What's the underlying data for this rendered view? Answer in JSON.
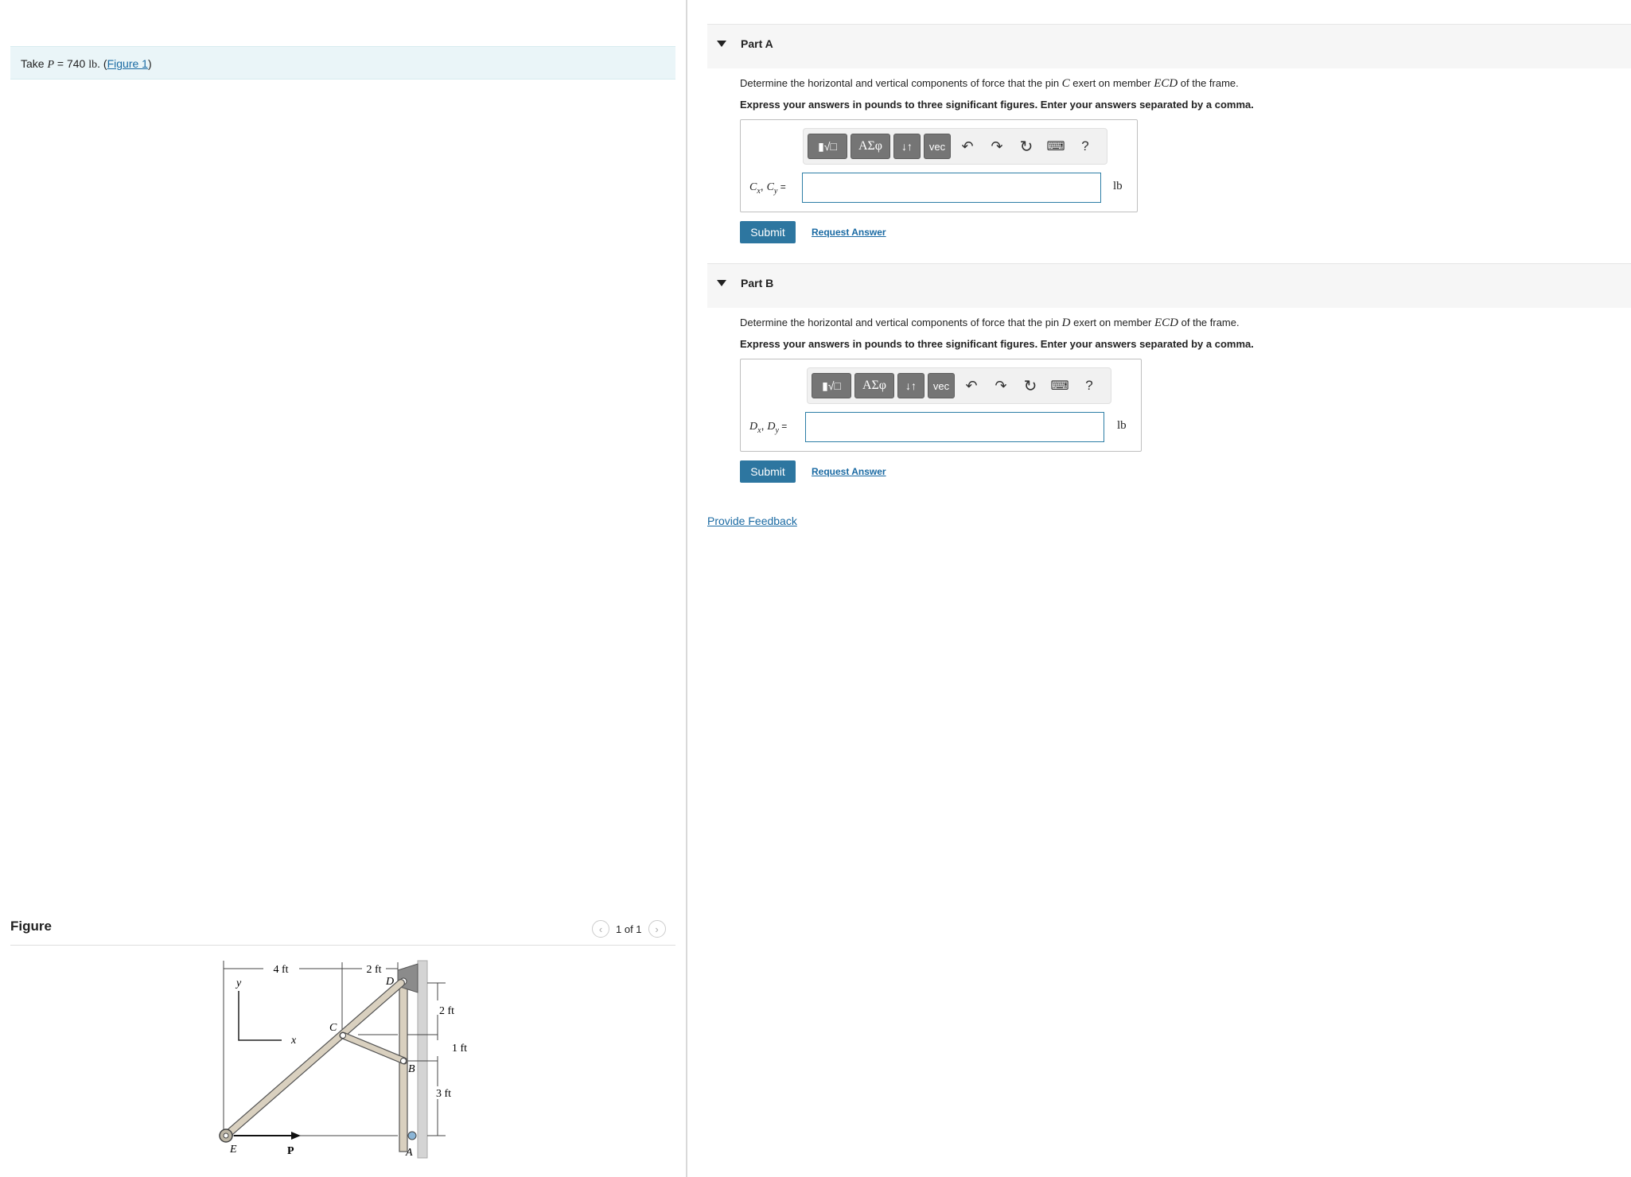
{
  "intro": {
    "take": "Take",
    "var": "P",
    "equals": " = 740 ",
    "unit": "lb",
    "period": ". (",
    "figure_link": "Figure 1",
    "close": ")"
  },
  "figure_panel": {
    "title": "Figure",
    "pager_text": "1 of 1",
    "prev_icon": "chevron-left-icon",
    "next_icon": "chevron-right-icon",
    "labels": {
      "dim_4ft": "4 ft",
      "dim_2ft_top": "2 ft",
      "dim_2ft_right": "2 ft",
      "dim_1ft": "1 ft",
      "dim_3ft": "3 ft",
      "axis_y": "y",
      "axis_x": "x",
      "point_D": "D",
      "point_C": "C",
      "point_B": "B",
      "point_A": "A",
      "point_E": "E",
      "force_P": "P"
    }
  },
  "parts": [
    {
      "title": "Part A",
      "question_pre": "Determine the horizontal and vertical components of force that the pin ",
      "question_pin": "C",
      "question_mid": " exert on member ",
      "question_member": "ECD",
      "question_post": " of the frame.",
      "instruction": "Express your answers in pounds to three significant figures. Enter your answers separated by a comma.",
      "toolbar": {
        "templates": "▮√□",
        "greek": "ΑΣφ",
        "arrows": "↓↑",
        "vec": "vec",
        "help": "?"
      },
      "label_a": "C",
      "label_a_sub": "x",
      "label_b": "C",
      "label_b_sub": "y",
      "label_eq": " =",
      "input_value": "",
      "unit": "lb",
      "submit": "Submit",
      "request": "Request Answer"
    },
    {
      "title": "Part B",
      "question_pre": "Determine the horizontal and vertical components of force that the pin ",
      "question_pin": "D",
      "question_mid": " exert on member ",
      "question_member": "ECD",
      "question_post": " of the frame.",
      "instruction": "Express your answers in pounds to three significant figures. Enter your answers separated by a comma.",
      "toolbar": {
        "templates": "▮√□",
        "greek": "ΑΣφ",
        "arrows": "↓↑",
        "vec": "vec",
        "help": "?"
      },
      "label_a": "D",
      "label_a_sub": "x",
      "label_b": "D",
      "label_b_sub": "y",
      "label_eq": " =",
      "input_value": "",
      "unit": "lb",
      "submit": "Submit",
      "request": "Request Answer"
    }
  ],
  "feedback": "Provide Feedback",
  "colors": {
    "accent": "#2d76a0",
    "link": "#1a6aa3",
    "intro_bg": "#eaf5f8"
  }
}
